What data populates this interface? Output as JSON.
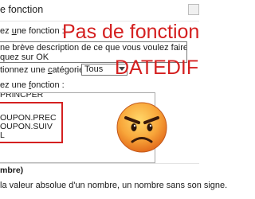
{
  "dialog": {
    "title": "e fonction"
  },
  "search": {
    "label_prefix": "ez ",
    "label_underlined": "u",
    "label_rest": "ne fonction :",
    "line1": "ne brève description de ce que vous voulez faire,",
    "line2": "quez sur OK"
  },
  "category": {
    "label_prefix": "tionnez une ",
    "label_underlined": "c",
    "label_rest": "atégorie :",
    "selected": "Tous"
  },
  "function_list": {
    "label_prefix": "ez une ",
    "label_underlined": "f",
    "label_rest": "onction :",
    "items": [
      "PRINCPER",
      "OUPON.PREC",
      "OUPON.SUIV",
      "L"
    ]
  },
  "overlay": {
    "line1": "Pas de fonction",
    "line2": "DATEDIF"
  },
  "details": {
    "name": "mbre)",
    "description": "la valeur absolue d'un nombre, un nombre sans son signe."
  }
}
